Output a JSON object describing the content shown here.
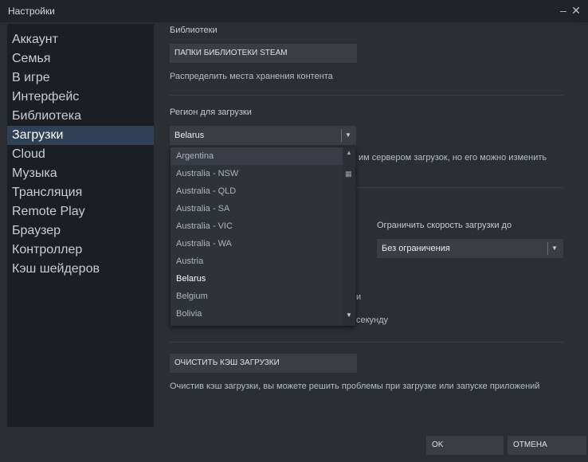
{
  "window": {
    "title": "Настройки",
    "minimize_glyph": "–",
    "close_glyph": "✕"
  },
  "sidebar": {
    "items": [
      {
        "label": "Аккаунт"
      },
      {
        "label": "Семья"
      },
      {
        "label": "В игре"
      },
      {
        "label": "Интерфейс"
      },
      {
        "label": "Библиотека"
      },
      {
        "label": "Загрузки"
      },
      {
        "label": "Cloud"
      },
      {
        "label": "Музыка"
      },
      {
        "label": "Трансляция"
      },
      {
        "label": "Remote Play"
      },
      {
        "label": "Браузер"
      },
      {
        "label": "Контроллер"
      },
      {
        "label": "Кэш шейдеров"
      }
    ],
    "active": "Загрузки"
  },
  "libraries": {
    "heading": "Библиотеки",
    "button_label": "ПАПКИ БИБЛИОТЕКИ STEAM",
    "description": "Распределить места хранения контента"
  },
  "region": {
    "heading": "Регион для загрузки",
    "selected": "Belarus",
    "description_visible": "им сервером загрузок, но его можно изменить",
    "options": [
      "Argentina",
      "Australia - NSW",
      "Australia - QLD",
      "Australia - SA",
      "Australia - VIC",
      "Australia - WA",
      "Austria",
      "Belarus",
      "Belgium",
      "Bolivia"
    ]
  },
  "bandwidth": {
    "label": "Ограничить скорость загрузки до",
    "selected": "Без ограничения"
  },
  "partially_hidden": {
    "line1_tail": "и",
    "line2_tail": "секунду"
  },
  "cache": {
    "button_label": "ОЧИСТИТЬ КЭШ ЗАГРУЗКИ",
    "description": "Очистив кэш загрузки, вы можете решить проблемы при загрузке или запуске приложений"
  },
  "footer": {
    "ok_label": "OK",
    "cancel_label": "ОТМЕНА"
  },
  "icons": {
    "dropdown_arrow": "▼",
    "scroll_up": "▲",
    "scroll_grip": "▦",
    "scroll_down": "▼"
  }
}
